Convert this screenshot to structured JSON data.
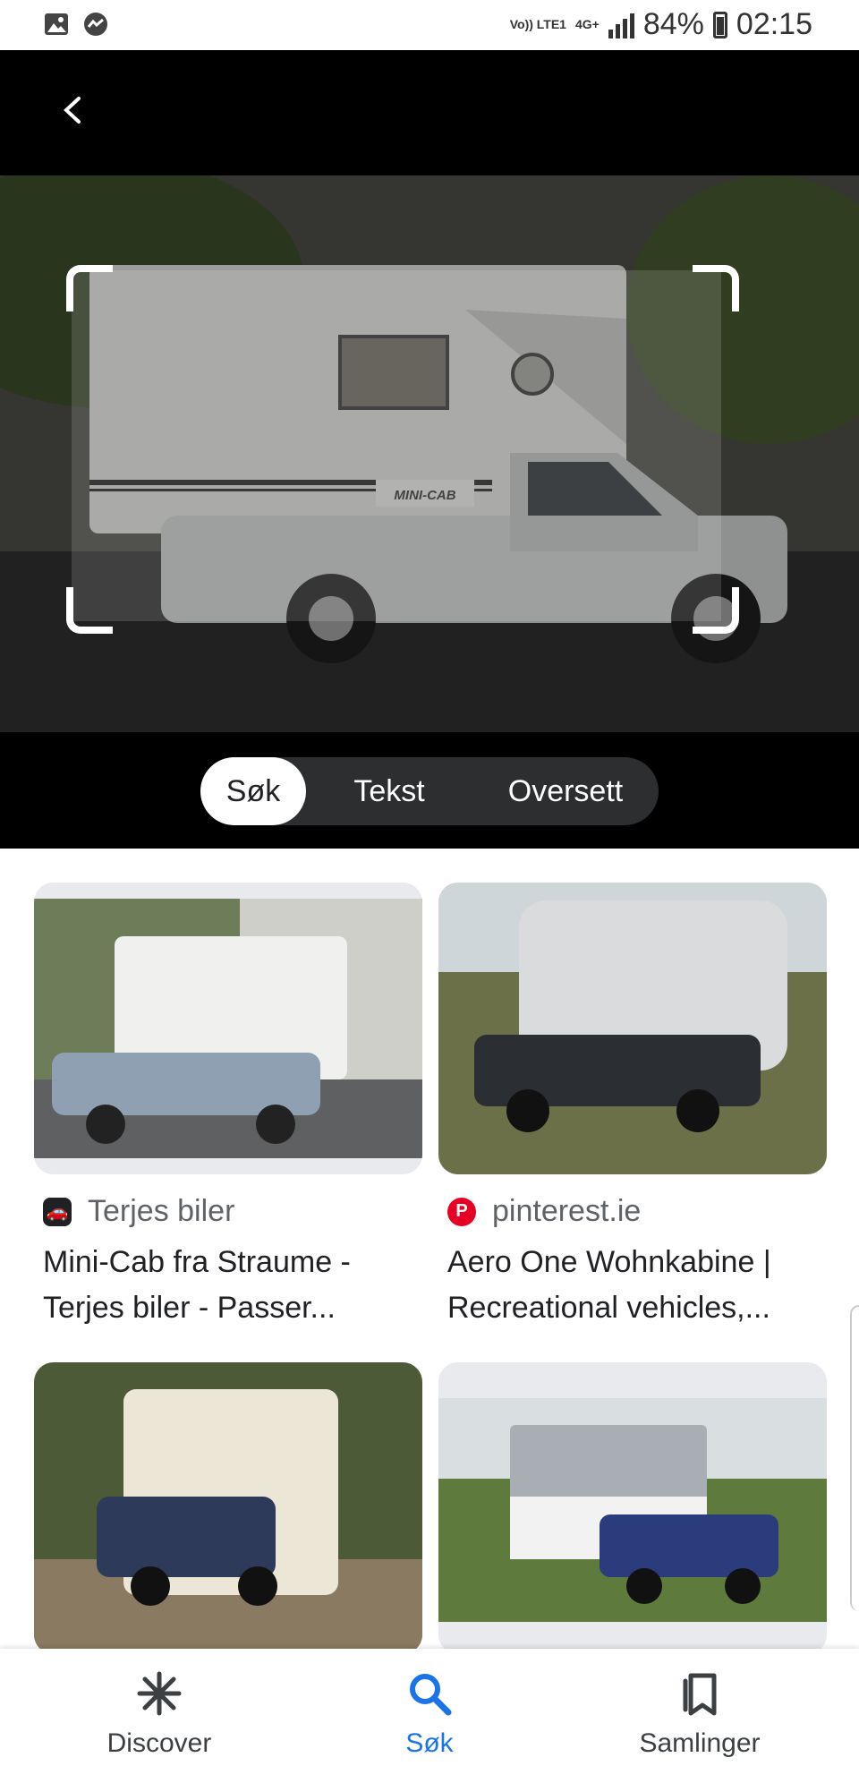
{
  "status_bar": {
    "network_line1": "Vo)) LTE1",
    "network_line2": "4G+",
    "battery": "84%",
    "time": "02:15"
  },
  "lens": {
    "modes": [
      "Søk",
      "Tekst",
      "Oversett"
    ],
    "active_mode": "Søk",
    "photo_caption_plate": "MINI-CAB"
  },
  "results": [
    {
      "source": "Terjes biler",
      "title": "Mini-Cab fra Straume - Terjes biler - Passer...",
      "icon_color": "#202124"
    },
    {
      "source": "pinterest.ie",
      "title": "Aero One Wohnkabine | Recreational vehicles,...",
      "icon_color": "#e60023"
    },
    {
      "source": "",
      "title": ""
    },
    {
      "source": "",
      "title": ""
    }
  ],
  "bottom_nav": {
    "items": [
      "Discover",
      "Søk",
      "Samlinger"
    ],
    "active": "Søk"
  },
  "colors": {
    "accent": "#1a73e8",
    "dark": "#000000"
  }
}
